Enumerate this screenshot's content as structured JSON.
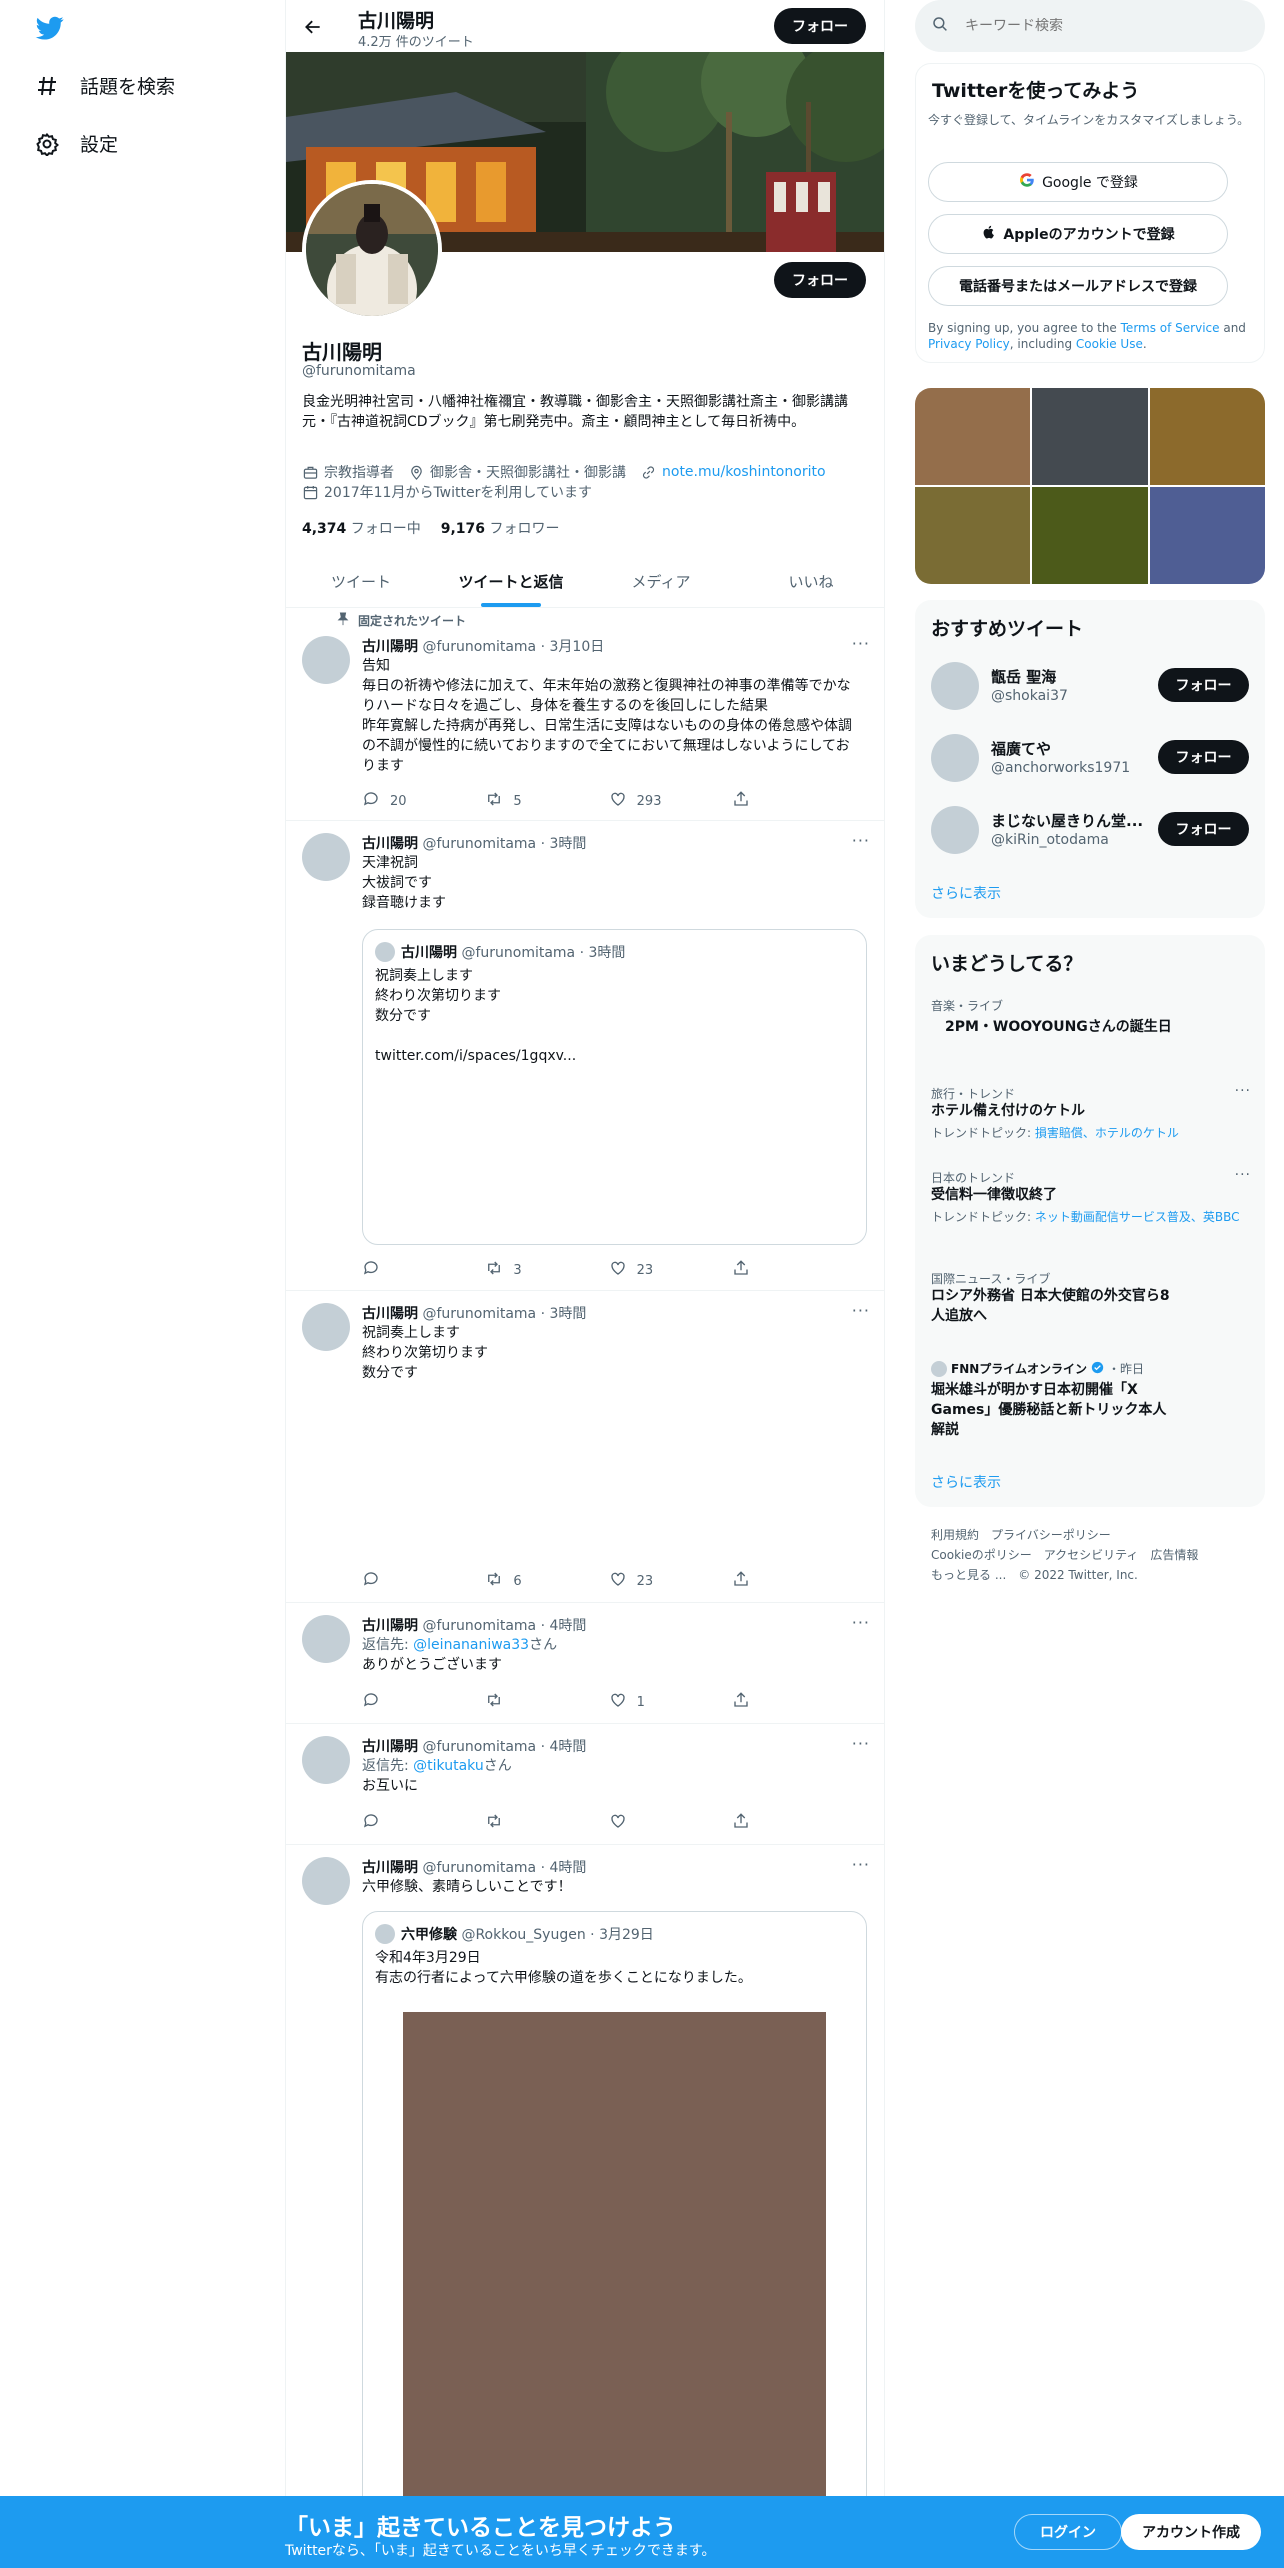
{
  "leftnav": {
    "explore_label": "話題を検索",
    "settings_label": "設定"
  },
  "header": {
    "name": "古川陽明",
    "tweet_count": "4.2万 件のツイート",
    "follow_label": "フォロー"
  },
  "profile": {
    "follow_label": "フォロー",
    "name": "古川陽明",
    "handle": "@furunomitama",
    "bio": "良金光明神社宮司・八幡神社権禰宜・教導職・御影舎主・天照御影講社斎主・御影講講元・『古神道祝詞CDブック』第七刷発売中。斎主・顧問神主として毎日祈祷中。",
    "category": "宗教指導者",
    "location": "御影舎・天照御影講社・御影講",
    "url": "note.mu/koshintonorito",
    "joined": "2017年11月からTwitterを利用しています",
    "following_count": "4,374",
    "following_label": "フォロー中",
    "followers_count": "9,176",
    "followers_label": "フォロワー"
  },
  "tabs": [
    "ツイート",
    "ツイートと返信",
    "メディア",
    "いいね"
  ],
  "pinned_label": "固定されたツイート",
  "tweets": [
    {
      "name": "古川陽明",
      "handle": "@furunomitama",
      "time": "3月10日",
      "text": "告知\n毎日の祈祷や修法に加えて、年末年始の激務と復興神社の神事の準備等でかなりハードな日々を過ごし、身体を養生するのを後回しにした結果\n昨年寛解した持病が再発し、日常生活に支障はないものの身体の倦怠感や体調の不調が慢性的に続いておりますので全てにおいて無理はしないようにしております",
      "reply": "20",
      "retweet": "5",
      "like": "293"
    },
    {
      "name": "古川陽明",
      "handle": "@furunomitama",
      "time": "3時間",
      "text": "天津祝詞\n大祓詞です\n録音聴けます",
      "quote": {
        "name": "古川陽明",
        "handle": "@furunomitama",
        "time": "3時間",
        "text": "祝詞奏上します\n終わり次第切ります\n数分です\n\ntwitter.com/i/spaces/1gqxv..."
      },
      "reply": "",
      "retweet": "3",
      "like": "23"
    },
    {
      "name": "古川陽明",
      "handle": "@furunomitama",
      "time": "3時間",
      "text": "祝詞奏上します\n終わり次第切ります\n数分です",
      "reply": "",
      "retweet": "6",
      "like": "23"
    },
    {
      "name": "古川陽明",
      "handle": "@furunomitama",
      "time": "4時間",
      "reply_prefix": "返信先: ",
      "reply_to": "@leinananiwa33",
      "reply_suffix": "さん",
      "text": "ありがとうございます",
      "reply": "",
      "retweet": "",
      "like": "1"
    },
    {
      "name": "古川陽明",
      "handle": "@furunomitama",
      "time": "4時間",
      "reply_prefix": "返信先: ",
      "reply_to": "@tikutaku",
      "reply_suffix": "さん",
      "text": "お互いに",
      "reply": "",
      "retweet": "",
      "like": ""
    },
    {
      "name": "古川陽明",
      "handle": "@furunomitama",
      "time": "4時間",
      "text": "六甲修験、素晴らしいことです！",
      "quote": {
        "name": "六甲修験",
        "handle": "@Rokkou_Syugen",
        "time": "3月29日",
        "text": "令和4年3月29日\n有志の行者によって六甲修験の道を歩くことになりました。"
      }
    }
  ],
  "right": {
    "search_placeholder": "キーワード検索",
    "signup_title": "Twitterを使ってみよう",
    "signup_sub": "今すぐ登録して、タイムラインをカスタマイズしましょう。",
    "google_label": "Google で登録",
    "apple_label": "Appleのアカウントで登録",
    "phone_label": "電話番号またはメールアドレスで登録",
    "terms_pre": "By signing up, you agree to the ",
    "terms_link": "Terms of Service",
    "terms_mid": " and ",
    "privacy_link": "Privacy Policy",
    "terms_mid2": ", including ",
    "cookie_link": "Cookie Use",
    "terms_end": ".",
    "rec_title": "おすすめツイート",
    "recs": [
      {
        "name": "甑岳 聖海",
        "handle": "@shokai37"
      },
      {
        "name": "福廣てや",
        "handle": "@anchorworks1971"
      },
      {
        "name": "まじない屋きりん堂...",
        "handle": "@kiRin_otodama"
      }
    ],
    "rec_follow": "フォロー",
    "show_more": "さらに表示",
    "trend_title": "いまどうしてる？",
    "trends": [
      {
        "cat": "音楽・ライブ",
        "title": "　2PM・WOOYOUNGさんの誕生日"
      },
      {
        "cat": "旅行・トレンド",
        "title": "ホテル備え付けのケトル",
        "sub_pre": "トレンドトピック: ",
        "sub_links": "損害賠償、ホテルのケトル"
      },
      {
        "cat": "日本のトレンド",
        "title": "受信料一律徴収終了",
        "sub_pre": "トレンドトピック: ",
        "sub_links": "ネット動画配信サービス普及、英BBC"
      },
      {
        "cat": "国際ニュース・ライブ",
        "title": "ロシア外務省 日本大使館の外交官ら8人追放へ"
      },
      {
        "cat": "FNNプライムオンライン",
        "cat_time": "・昨日",
        "title": "堀米雄斗が明かす日本初開催「X Games」優勝秘話と新トリック本人解説"
      }
    ],
    "show_more2": "さらに表示",
    "footer": [
      "利用規約",
      "プライバシーポリシー",
      "Cookieのポリシー",
      "アクセシビリティ",
      "広告情報",
      "もっと見る ...",
      "© 2022 Twitter, Inc."
    ]
  },
  "bottom": {
    "title": "「いま」起きていることを見つけよう",
    "subtitle": "Twitterなら、「いま」起きていることをいち早くチェックできます。",
    "login": "ログイン",
    "signup": "アカウント作成"
  },
  "colors": {
    "accent": "#1d9bf0",
    "text": "#0f1419",
    "muted": "#536471",
    "media": [
      "#946e4b",
      "#444a50",
      "#8c6a2c",
      "#7a6c34",
      "#4c5a1a",
      "#4f5e94"
    ],
    "quote_image": "#7a6054"
  }
}
